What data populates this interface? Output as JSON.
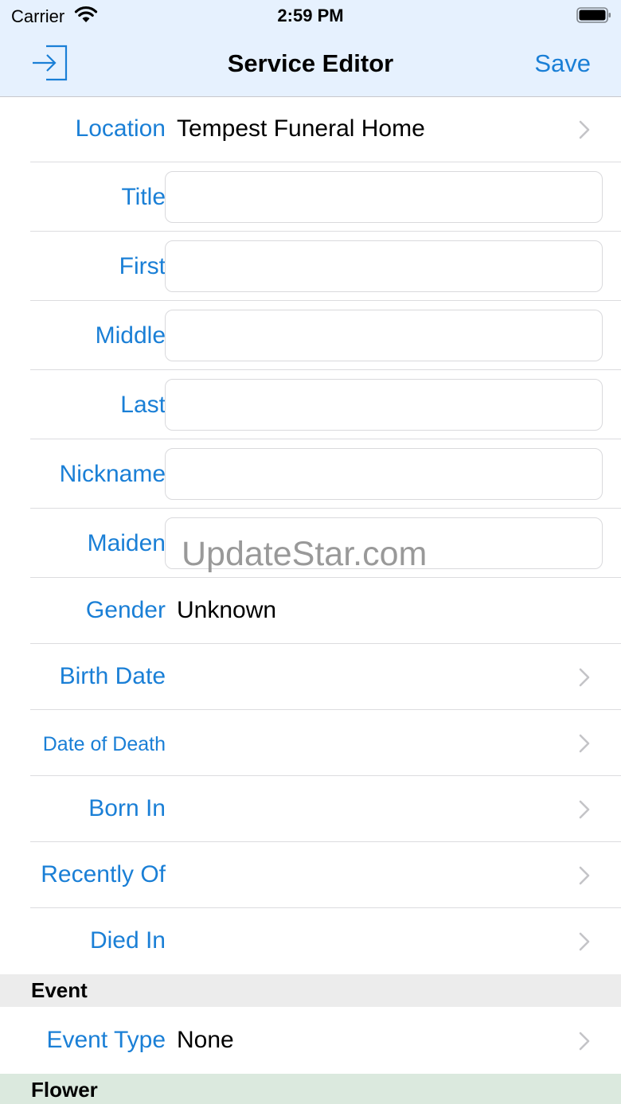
{
  "status_bar": {
    "carrier": "Carrier",
    "time": "2:59 PM"
  },
  "nav": {
    "title": "Service Editor",
    "save_label": "Save",
    "exit_icon": "exit-icon"
  },
  "rows": {
    "location": {
      "label": "Location",
      "value": "Tempest Funeral Home"
    },
    "title": {
      "label": "Title",
      "value": ""
    },
    "first": {
      "label": "First",
      "value": ""
    },
    "middle": {
      "label": "Middle",
      "value": ""
    },
    "last": {
      "label": "Last",
      "value": ""
    },
    "nickname": {
      "label": "Nickname",
      "value": ""
    },
    "maiden": {
      "label": "Maiden",
      "value": ""
    },
    "gender": {
      "label": "Gender",
      "value": "Unknown"
    },
    "birth_date": {
      "label": "Birth Date"
    },
    "date_of_death": {
      "label": "Date of Death"
    },
    "born_in": {
      "label": "Born In"
    },
    "recently_of": {
      "label": "Recently Of"
    },
    "died_in": {
      "label": "Died In"
    }
  },
  "sections": {
    "event": {
      "header": "Event",
      "event_type": {
        "label": "Event Type",
        "value": "None"
      }
    },
    "flower": {
      "header": "Flower"
    }
  },
  "watermark": "UpdateStar.com",
  "colors": {
    "accent": "#1a7fd6",
    "nav_background": "#e6f1fe",
    "event_header_bg": "#ececec",
    "flower_header_bg": "#dbe9de"
  }
}
